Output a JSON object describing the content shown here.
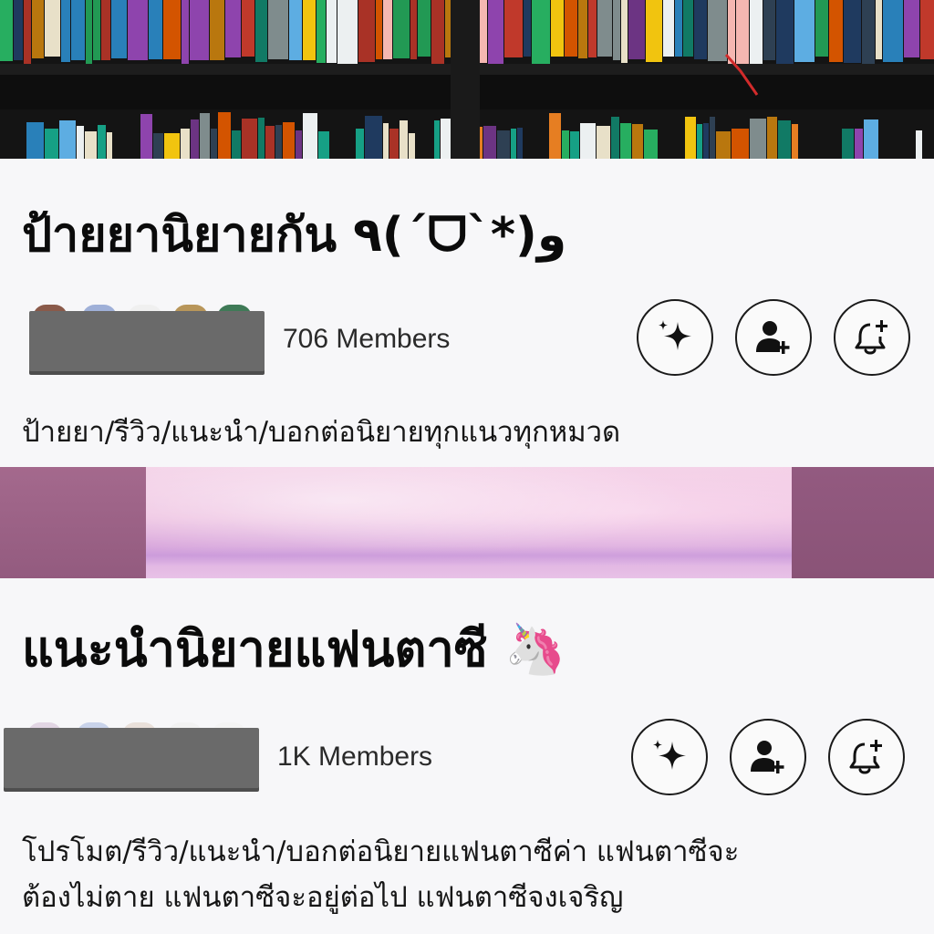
{
  "groups": [
    {
      "name": "ป้ายยานิยายกัน ٩(ˊᗜˋ*)و",
      "members": "706 Members",
      "description": "ป้ายยา/รีวิว/แนะนำ/บอกต่อนิยายทุกแนวทุกหมวด",
      "banner": "bookshelf"
    },
    {
      "name": "แนะนำนิยายแฟนตาซี 🦄",
      "members": "1K Members",
      "description_line1": "โปรโมต/รีวิว/แนะนำ/บอกต่อนิยายแฟนตาซีค่า แฟนตาซีจะ",
      "description_line2": "ต้องไม่ตาย แฟนตาซีจะอยู่ต่อไป แฟนตาซีจงเจริญ",
      "banner": "pink-sky"
    }
  ],
  "actions": {
    "ai_icon": "sparkle-icon",
    "join_icon": "add-person-icon",
    "notify_icon": "bell-plus-icon"
  },
  "colors": {
    "background": "#f7f7f9",
    "button_border": "#1a1a1a",
    "redaction": "#6a6a6a"
  }
}
